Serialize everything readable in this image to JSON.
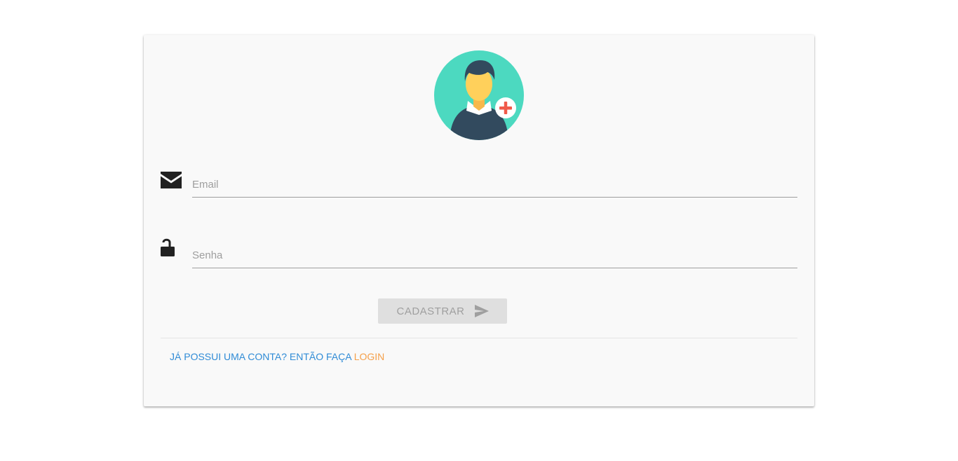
{
  "form": {
    "email_placeholder": "Email",
    "email_icon": "envelope-icon",
    "password_placeholder": "Senha",
    "password_icon": "unlock-icon",
    "submit_label": "CADASTRAR",
    "submit_icon": "send-icon",
    "submit_enabled": false
  },
  "avatar": {
    "icon": "user-add-avatar-icon"
  },
  "footer": {
    "prompt_text": "JÁ POSSUI UMA CONTA? ENTÃO FAÇA ",
    "login_text": "LOGIN"
  },
  "colors": {
    "page_background": "#ffffff",
    "card_background": "#f9f9f9",
    "avatar_circle": "#4cd9c0",
    "avatar_shirt": "#324a5e",
    "avatar_face": "#ffd05b",
    "add_badge_cross": "#f05a4a",
    "link_blue": "#2f8bd6",
    "link_orange": "#f5a04a",
    "button_disabled_bg": "#dfdfdf",
    "button_disabled_text": "#9f9f9f"
  }
}
